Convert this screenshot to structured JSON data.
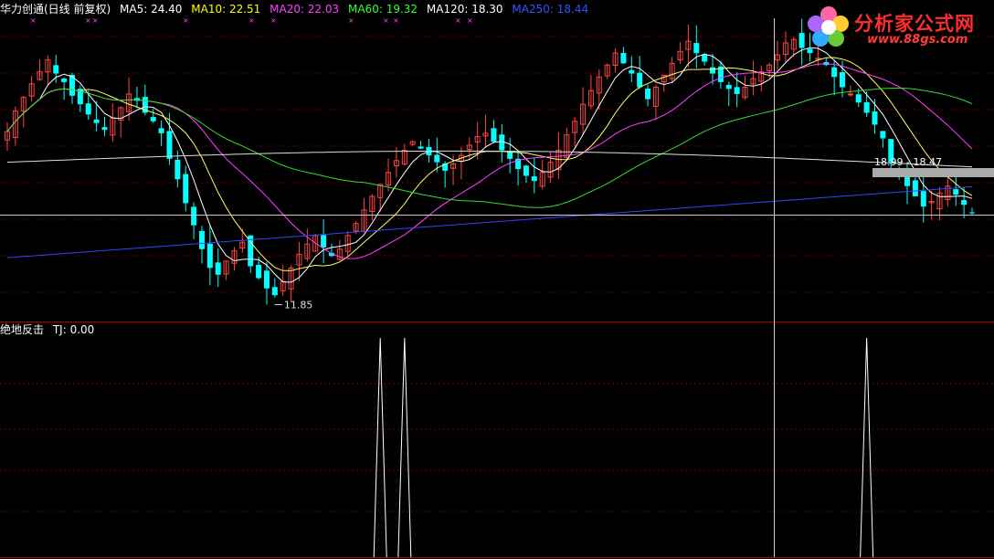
{
  "title_bar": {
    "stock_title": "华力创通(日线 前复权)",
    "indicators": [
      {
        "label": "MA5: 24.40",
        "color": "#ffffff"
      },
      {
        "label": "MA10: 22.51",
        "color": "#ffff00"
      },
      {
        "label": "MA20: 22.03",
        "color": "#ff40ff"
      },
      {
        "label": "MA60: 19.32",
        "color": "#33ff33"
      },
      {
        "label": "MA120: 18.30",
        "color": "#ffffff"
      },
      {
        "label": "MA250: 18.44",
        "color": "#3355ff"
      }
    ]
  },
  "sub_panel": {
    "title": "绝地反击",
    "value_label": "TJ: 0.00"
  },
  "logo": {
    "title": "分析家公式网",
    "url": "www.88gs.com"
  },
  "annotations": {
    "low_label": "11.85",
    "range_label": "18.99 - 18.47"
  },
  "colors": {
    "up": "#ff4444",
    "down": "#00ffff",
    "grid": "#7a0000",
    "ma5": "#ffffff",
    "ma10": "#ffff66",
    "ma20": "#ff40ff",
    "ma60": "#33dd33",
    "ma120": "#dddddd",
    "ma250": "#3344ff",
    "tj": "#ffffff"
  },
  "chart_data": {
    "type": "candlestick",
    "price_range": [
      11.5,
      28.0
    ],
    "low_marker": 11.85,
    "candle_closes": [
      22.0,
      23.2,
      24.0,
      24.8,
      25.5,
      26.2,
      25.4,
      24.9,
      24.1,
      23.6,
      23.0,
      22.5,
      22.1,
      22.8,
      23.4,
      24.2,
      23.8,
      23.1,
      22.6,
      21.9,
      20.4,
      19.2,
      17.8,
      16.5,
      15.1,
      14.0,
      13.6,
      14.4,
      15.0,
      15.5,
      14.1,
      13.4,
      12.8,
      12.4,
      13.2,
      14.0,
      14.8,
      15.4,
      15.9,
      15.2,
      14.7,
      15.1,
      15.9,
      16.6,
      17.4,
      18.2,
      18.9,
      19.6,
      20.3,
      20.9,
      21.4,
      21.0,
      20.6,
      20.2,
      19.7,
      20.1,
      20.6,
      21.2,
      21.7,
      21.9,
      21.4,
      20.9,
      20.4,
      19.8,
      19.4,
      19.1,
      19.6,
      20.2,
      20.9,
      21.8,
      22.6,
      23.6,
      24.4,
      25.2,
      25.9,
      26.6,
      26.0,
      25.4,
      24.6,
      23.9,
      24.6,
      25.3,
      26.0,
      26.7,
      27.3,
      26.6,
      26.1,
      25.4,
      24.9,
      24.5,
      24.2,
      24.6,
      25.1,
      25.5,
      25.9,
      26.5,
      27.2,
      27.4,
      26.9,
      26.6,
      26.3,
      25.9,
      25.2,
      24.6,
      24.2,
      23.7,
      23.1,
      22.4,
      21.6,
      20.2,
      19.5,
      18.8,
      18.2,
      17.6,
      17.9,
      18.4,
      18.8,
      18.3,
      17.7,
      17.2
    ],
    "tj_signal_candle_indexes": [
      46,
      49,
      106
    ],
    "tj_range": [
      0,
      1
    ]
  }
}
